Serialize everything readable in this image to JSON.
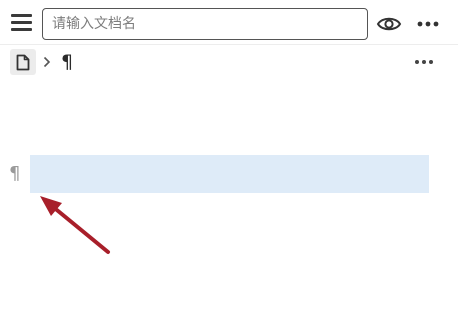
{
  "toolbar": {
    "menu_icon": "hamburger-menu-icon",
    "title_input": {
      "value": "",
      "placeholder": "请输入文档名"
    },
    "preview_icon": "eye-icon",
    "more_icon": "more-horizontal-icon"
  },
  "breadcrumb": {
    "doc_icon": "document-icon",
    "separator_icon": "chevron-right-icon",
    "current": "¶",
    "more_icon": "more-horizontal-icon"
  },
  "editor": {
    "block_handle": "¶",
    "block_text": "",
    "selected_block_color": "#deebf8"
  },
  "annotation": {
    "arrow_color": "#a81f2a",
    "arrow_icon": "pointer-arrow-icon"
  }
}
